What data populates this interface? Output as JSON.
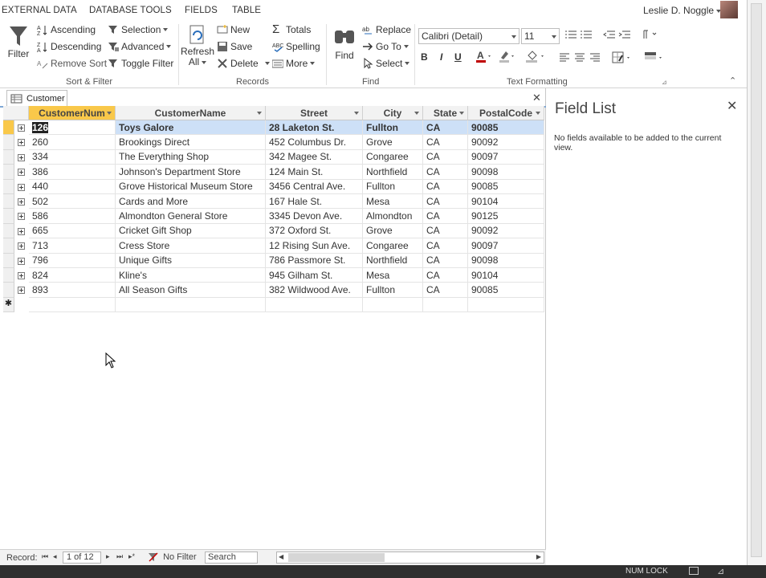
{
  "ribbon_tabs": [
    "EXTERNAL DATA",
    "DATABASE TOOLS",
    "FIELDS",
    "TABLE"
  ],
  "user": {
    "name": "Leslie D. Noggle"
  },
  "sort_filter": {
    "filter": "Filter",
    "ascending": "Ascending",
    "descending": "Descending",
    "remove_sort": "Remove Sort",
    "selection": "Selection",
    "advanced": "Advanced",
    "toggle_filter": "Toggle Filter",
    "label": "Sort & Filter"
  },
  "records": {
    "refresh_all": "Refresh",
    "refresh_all2": "All",
    "new": "New",
    "save": "Save",
    "delete": "Delete",
    "totals": "Totals",
    "spelling": "Spelling",
    "more": "More",
    "label": "Records"
  },
  "find": {
    "find": "Find",
    "replace": "Replace",
    "go_to": "Go To",
    "select": "Select",
    "label": "Find"
  },
  "text_formatting": {
    "font": "Calibri (Detail)",
    "size": "11",
    "bold": "B",
    "italic": "I",
    "underline": "U",
    "label": "Text Formatting"
  },
  "document_tab": "Customer",
  "table": {
    "columns": [
      "CustomerNum",
      "CustomerName",
      "Street",
      "City",
      "State",
      "PostalCode"
    ],
    "rows": [
      [
        "126",
        "Toys Galore",
        "28 Laketon St.",
        "Fullton",
        "CA",
        "90085"
      ],
      [
        "260",
        "Brookings Direct",
        "452 Columbus Dr.",
        "Grove",
        "CA",
        "90092"
      ],
      [
        "334",
        "The Everything Shop",
        "342 Magee St.",
        "Congaree",
        "CA",
        "90097"
      ],
      [
        "386",
        "Johnson's Department Store",
        "124 Main St.",
        "Northfield",
        "CA",
        "90098"
      ],
      [
        "440",
        "Grove Historical Museum Store",
        "3456 Central Ave.",
        "Fullton",
        "CA",
        "90085"
      ],
      [
        "502",
        "Cards and More",
        "167 Hale St.",
        "Mesa",
        "CA",
        "90104"
      ],
      [
        "586",
        "Almondton General Store",
        "3345 Devon Ave.",
        "Almondton",
        "CA",
        "90125"
      ],
      [
        "665",
        "Cricket Gift Shop",
        "372 Oxford St.",
        "Grove",
        "CA",
        "90092"
      ],
      [
        "713",
        "Cress Store",
        "12 Rising Sun Ave.",
        "Congaree",
        "CA",
        "90097"
      ],
      [
        "796",
        "Unique Gifts",
        "786 Passmore St.",
        "Northfield",
        "CA",
        "90098"
      ],
      [
        "824",
        "Kline's",
        "945 Gilham St.",
        "Mesa",
        "CA",
        "90104"
      ],
      [
        "893",
        "All Season Gifts",
        "382 Wildwood Ave.",
        "Fullton",
        "CA",
        "90085"
      ]
    ]
  },
  "record_nav": {
    "record_label": "Record:",
    "position": "1 of 12",
    "no_filter": "No Filter",
    "search": "Search"
  },
  "field_list": {
    "title": "Field List",
    "message": "No fields available to be added to the current view."
  },
  "status": {
    "num_lock": "NUM LOCK"
  },
  "colors": {
    "accent": "#a4373a",
    "header_active": "#f9c84a",
    "selected_row": "#cde0f7"
  }
}
